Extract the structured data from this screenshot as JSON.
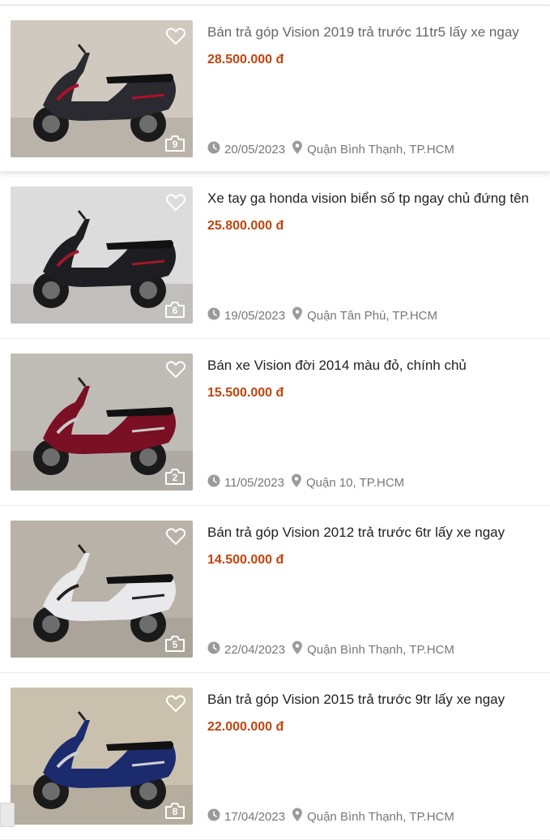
{
  "listings": [
    {
      "title": "Bán trả góp Vision 2019 trả trước 11tr5 lấy xe ngay",
      "price": "28.500.000 đ",
      "date": "20/05/2023",
      "location": "Quận Bình Thạnh, TP.HCM",
      "photos": "9",
      "bike_color": "#2a2a30",
      "accent": "#b0102a",
      "bg": "#cfc9bf"
    },
    {
      "title": "Xe tay ga honda vision biển số tp ngay chủ đứng tên",
      "price": "25.800.000 đ",
      "date": "19/05/2023",
      "location": "Quận Tân Phú, TP.HCM",
      "photos": "6",
      "bike_color": "#1e1e22",
      "accent": "#a0182a",
      "bg": "#dcdcdc"
    },
    {
      "title": "Bán xe Vision đời 2014 màu đỏ, chính chủ",
      "price": "15.500.000 đ",
      "date": "11/05/2023",
      "location": "Quận 10, TP.HCM",
      "photos": "2",
      "bike_color": "#7a1024",
      "accent": "#c9c9c9",
      "bg": "#bfbcb6"
    },
    {
      "title": "Bán trả góp Vision 2012 trả trước 6tr lấy xe ngay",
      "price": "14.500.000 đ",
      "date": "22/04/2023",
      "location": "Quận Bình Thạnh, TP.HCM",
      "photos": "5",
      "bike_color": "#e9e9ec",
      "accent": "#222222",
      "bg": "#b8b2a8"
    },
    {
      "title": "Bán trả góp Vision 2015 trả trước 9tr lấy xe ngay",
      "price": "22.000.000 đ",
      "date": "17/04/2023",
      "location": "Quận Bình Thạnh, TP.HCM",
      "photos": "8",
      "bike_color": "#1c2a6e",
      "accent": "#cfcfd6",
      "bg": "#c9c0ae"
    }
  ],
  "colors": {
    "price": "#c0440e",
    "meta": "#777777",
    "icon": "#9a9a9a"
  }
}
